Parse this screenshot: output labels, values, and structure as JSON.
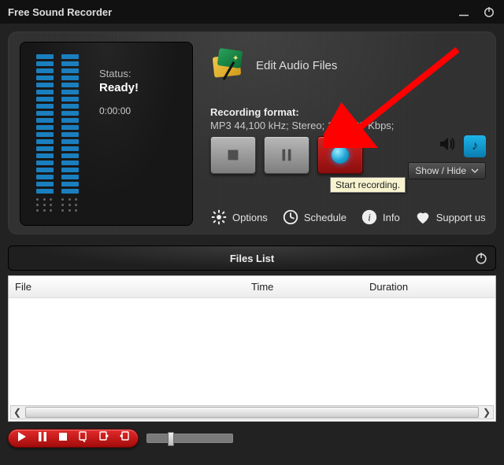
{
  "app": {
    "title": "Free Sound Recorder"
  },
  "status": {
    "label": "Status:",
    "value": "Ready!",
    "time": "0:00:00"
  },
  "edit": {
    "label": "Edit Audio Files"
  },
  "format": {
    "title": "Recording format:",
    "detail": "MP3 44,100 kHz; Stereo;  128-320 Kbps;"
  },
  "tooltip": {
    "record": "Start recording."
  },
  "showhide": {
    "label": "Show / Hide"
  },
  "utils": {
    "options": "Options",
    "schedule": "Schedule",
    "info": "Info",
    "support": "Support us"
  },
  "fileslist": {
    "title": "Files List",
    "cols": {
      "file": "File",
      "time": "Time",
      "duration": "Duration"
    }
  }
}
